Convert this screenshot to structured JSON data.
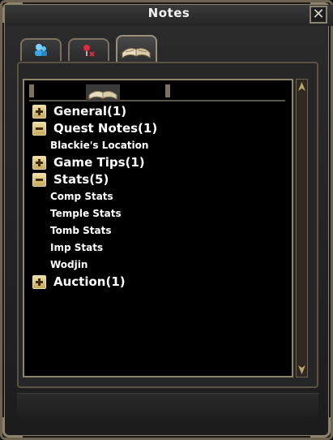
{
  "window": {
    "title": "Notes",
    "close_icon": "close-icon",
    "frame_color": "#8d826b"
  },
  "tabs": [
    {
      "icon": "people-icon",
      "active": false
    },
    {
      "icon": "pin-icon",
      "active": false
    },
    {
      "icon": "book-icon",
      "active": true
    }
  ],
  "tree": {
    "categories": [
      {
        "label": "General(1)",
        "expanded": false,
        "icon": "plus-icon",
        "notes": []
      },
      {
        "label": "Quest Notes(1)",
        "expanded": true,
        "icon": "minus-icon",
        "notes": [
          "Blackie's Location"
        ]
      },
      {
        "label": "Game Tips(1)",
        "expanded": false,
        "icon": "plus-icon",
        "notes": []
      },
      {
        "label": "Stats(5)",
        "expanded": true,
        "icon": "minus-icon",
        "notes": [
          "Comp Stats",
          "Temple Stats",
          "Tomb Stats",
          "Imp Stats",
          "Wodjin"
        ]
      },
      {
        "label": "Auction(1)",
        "expanded": false,
        "icon": "plus-icon",
        "notes": []
      }
    ]
  },
  "colors": {
    "text": "#ffffff",
    "category_icon": "#d9c27c",
    "list_border": "#8f846a"
  }
}
